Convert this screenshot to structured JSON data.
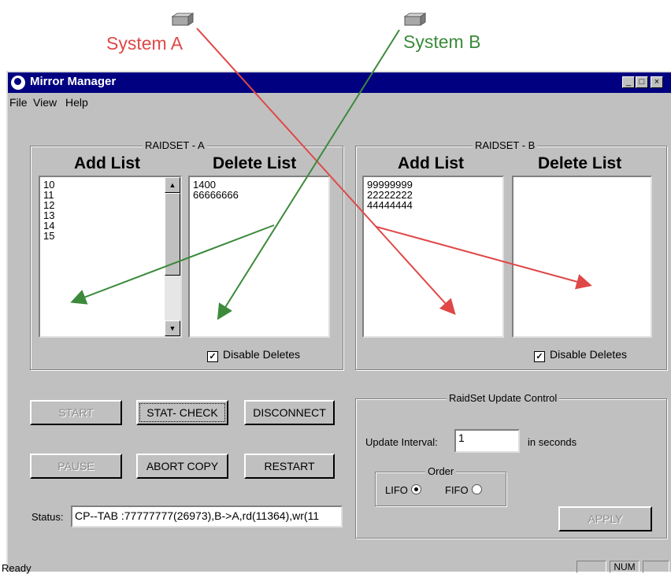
{
  "annotations": {
    "system_a_label": "System A",
    "system_b_label": "System B",
    "colors": {
      "system_a": "#e04848",
      "system_b": "#3c8a3c"
    }
  },
  "window": {
    "title": "Mirror Manager",
    "title_icon": "eye-icon",
    "controls": {
      "minimize": "_",
      "maximize": "□",
      "close": "×"
    },
    "menu": [
      "File",
      "View",
      "Help"
    ]
  },
  "raidset_a": {
    "title": "RAIDSET - A",
    "add_header": "Add List",
    "delete_header": "Delete List",
    "add_items": [
      "10",
      "11",
      "12",
      "13",
      "14",
      "15"
    ],
    "delete_items": [
      "1400",
      "66666666"
    ],
    "disable_deletes_label": "Disable Deletes",
    "disable_deletes_checked": true
  },
  "raidset_b": {
    "title": "RAIDSET - B",
    "add_header": "Add List",
    "delete_header": "Delete List",
    "add_items": [
      "99999999",
      "22222222",
      "44444444"
    ],
    "delete_items": [],
    "disable_deletes_label": "Disable Deletes",
    "disable_deletes_checked": true
  },
  "buttons": {
    "start": "START",
    "stat_check": "STAT- CHECK",
    "disconnect": "DISCONNECT",
    "pause": "PAUSE",
    "abort_copy": "ABORT COPY",
    "restart": "RESTART"
  },
  "status": {
    "label": "Status:",
    "value": "CP--TAB :77777777(26973),B->A,rd(11364),wr(11"
  },
  "update_control": {
    "title": "RaidSet Update Control",
    "interval_label": "Update Interval:",
    "interval_value": "1",
    "interval_unit": "in seconds",
    "order_title": "Order",
    "lifo_label": "LIFO",
    "fifo_label": "FIFO",
    "selected": "LIFO",
    "apply_label": "APPLY"
  },
  "statusbar": {
    "ready": "Ready",
    "num": "NUM"
  }
}
